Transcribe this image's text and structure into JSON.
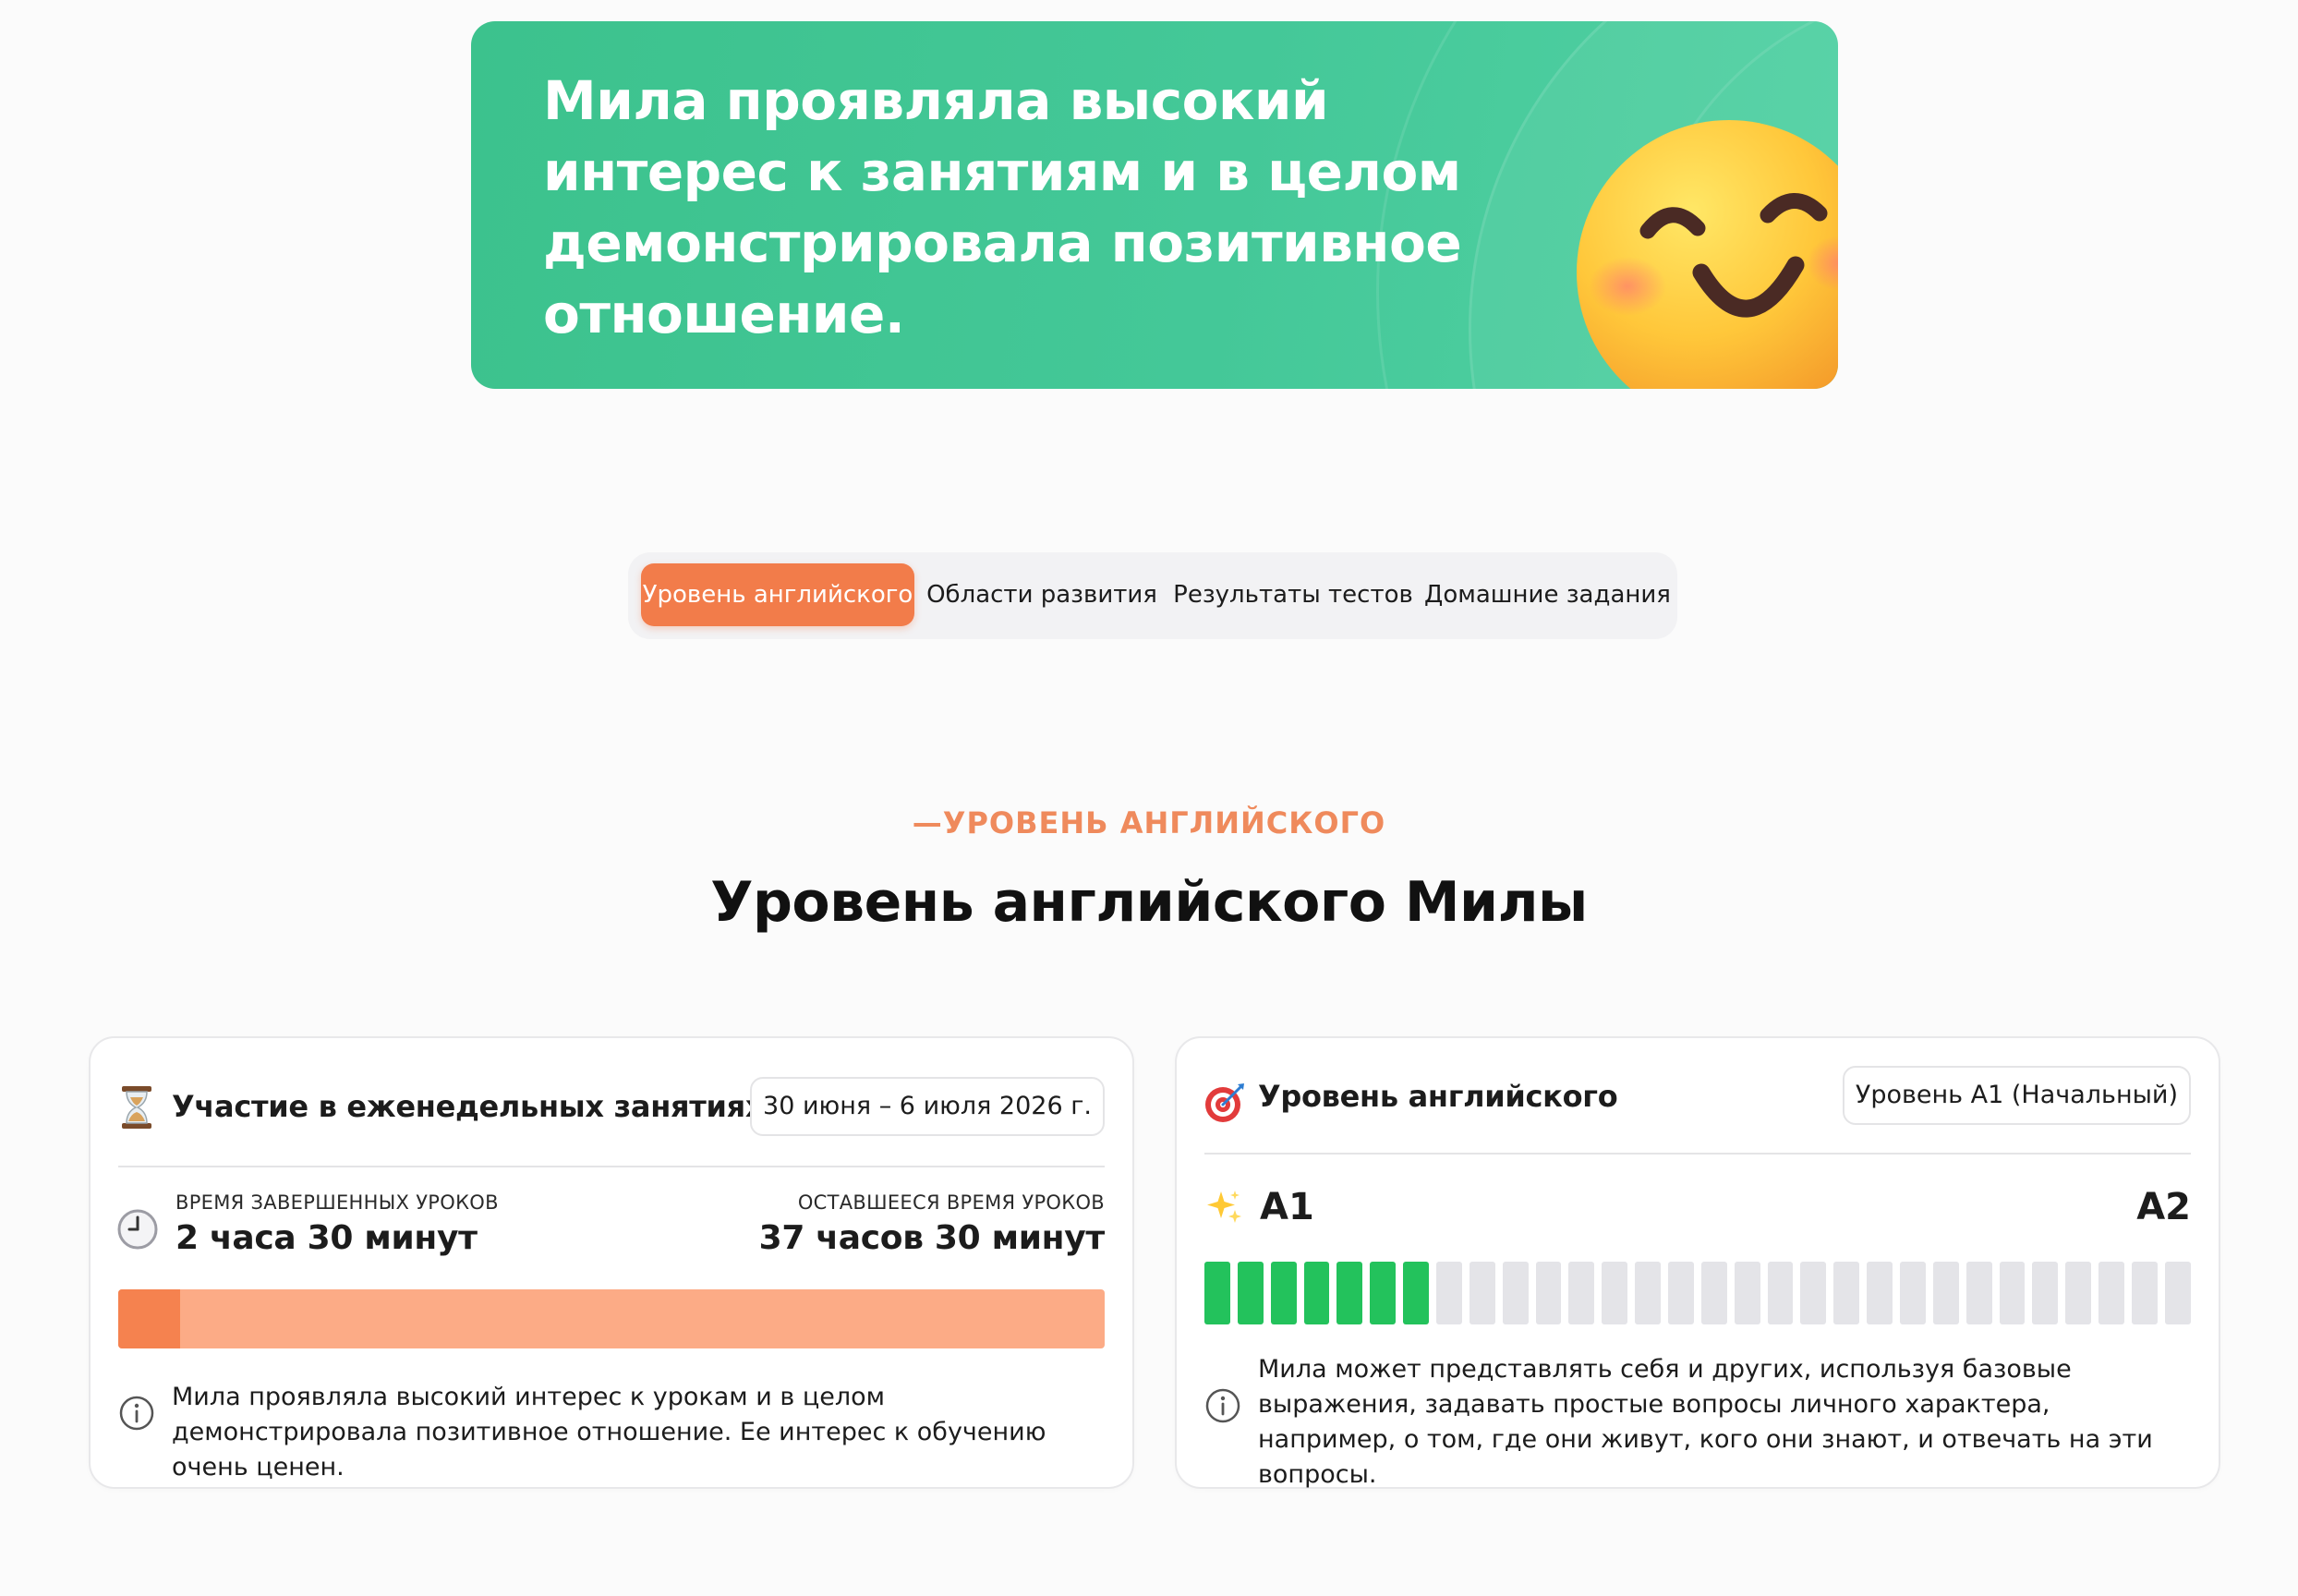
{
  "hero": {
    "text": "Мила проявляла высокий интерес к занятиям и в целом демонстрировала позитивное отношение.",
    "emoji_icon": "smiling-face-emoji"
  },
  "tabs": [
    {
      "label": "Уровень английского",
      "active": true
    },
    {
      "label": "Области развития",
      "active": false
    },
    {
      "label": "Результаты тестов",
      "active": false
    },
    {
      "label": "Домашние задания",
      "active": false
    }
  ],
  "section": {
    "eyebrow": "—УРОВЕНЬ АНГЛИЙСКОГО",
    "title": "Уровень английского Милы"
  },
  "attendance_card": {
    "icon": "hourglass-icon",
    "title": "Участие в еженедельных занятиях",
    "date_range": "30 июня – 6 июля 2026 г.",
    "completed_label": "ВРЕМЯ ЗАВЕРШЕННЫХ УРОКОВ",
    "completed_value": "2 часа 30 минут",
    "remaining_label": "ОСТАВШЕЕСЯ ВРЕМЯ УРОКОВ",
    "remaining_value": "37 часов 30 минут",
    "progress_fraction": 0.0625,
    "note": "Мила проявляла высокий интерес к урокам и в целом демонстрировала позитивное отношение. Ее интерес к обучению очень ценен."
  },
  "level_card": {
    "icon": "target-dart-icon",
    "title": "Уровень английского",
    "level_badge": "Уровень A1 (Начальный)",
    "from_level": "A1",
    "to_level": "A2",
    "segments_total": 30,
    "segments_filled": 7,
    "note": "Мила может представлять себя и других, используя базовые выражения, задавать простые вопросы личного характера, например, о том, где они живут, кого они знают, и отвечать на эти вопросы."
  },
  "colors": {
    "hero_green": "#3cc28d",
    "accent_orange": "#f27c4a",
    "progress_track": "#fcab86",
    "progress_fill": "#f5824f",
    "segment_on": "#23c25c",
    "segment_off": "#e4e4e8"
  }
}
